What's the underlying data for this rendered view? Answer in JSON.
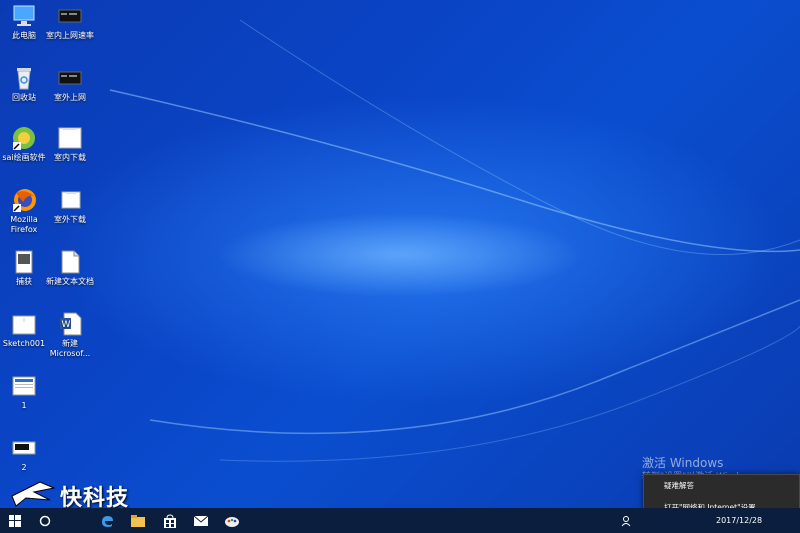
{
  "desktop": {
    "icons": [
      {
        "label": "此电脑",
        "icon": "this-pc-icon"
      },
      {
        "label": "室内上网速率",
        "icon": "image-file-icon"
      },
      {
        "label": "回收站",
        "icon": "recycle-bin-icon"
      },
      {
        "label": "室外上网",
        "icon": "image-file-icon"
      },
      {
        "label": "sai绘画软件",
        "icon": "sai-paint-icon"
      },
      {
        "label": "室内下载",
        "icon": "image-file-icon"
      },
      {
        "label": "Mozilla Firefox",
        "icon": "firefox-icon"
      },
      {
        "label": "室外下载",
        "icon": "image-file-icon"
      },
      {
        "label": "捕获",
        "icon": "image-file-icon"
      },
      {
        "label": "新建文本文档",
        "icon": "text-document-icon"
      },
      {
        "label": "Sketch001",
        "icon": "image-file-icon"
      },
      {
        "label": "新建 Microsof...",
        "icon": "word-document-icon"
      },
      {
        "label": "1",
        "icon": "image-file-icon"
      },
      {
        "label": "2",
        "icon": "image-file-icon"
      }
    ]
  },
  "watermark": {
    "line1": "激活 Windows",
    "line2": "转到\"设置\"以激活 Windows。"
  },
  "logo_text": "快科技",
  "popup": {
    "items": [
      "疑难解答",
      "打开\"网络和 Internet\"设置"
    ]
  },
  "taskbar": {
    "buttons": [
      "start-icon",
      "cortana-icon",
      "task-view-icon",
      "edge-icon",
      "explorer-icon",
      "store-icon",
      "mail-icon",
      "paint-icon"
    ],
    "clock_date": "2017/12/28"
  }
}
